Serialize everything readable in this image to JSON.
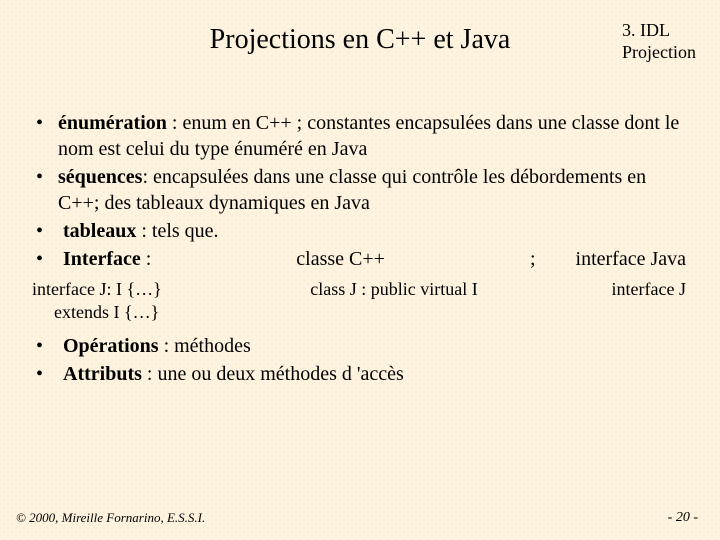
{
  "header": {
    "title": "Projections en C++ et Java",
    "corner_line1": "3. IDL",
    "corner_line2": "Projection"
  },
  "bullets": {
    "b1_bold": "énumération",
    "b1_rest": " : enum en C++ ; constantes encapsulées dans une classe dont le nom est celui du type énuméré en Java",
    "b2_bold": "séquences",
    "b2_rest": ": encapsulées dans une classe qui contrôle les débordements en C++; des tableaux dynamiques en Java",
    "b3_bold": "tableaux",
    "b3_rest": " : tels que.",
    "b4_bold": "Interface",
    "b4_after": " :",
    "b4_mid": "classe C++",
    "b4_sep": ";",
    "b4_right": "interface Java",
    "b5_bold": "Opérations",
    "b5_rest": " : méthodes",
    "b6_bold": "Attributs",
    "b6_rest": " : une ou deux méthodes d 'accès"
  },
  "code": {
    "c1_l1": "interface J: I {…}",
    "c1_l2": "extends I {…}",
    "c2": "class J : public virtual I",
    "c3": "interface J"
  },
  "footer": {
    "left": "© 2000, Mireille Fornarino, E.S.S.I.",
    "right": "- 20 -"
  }
}
